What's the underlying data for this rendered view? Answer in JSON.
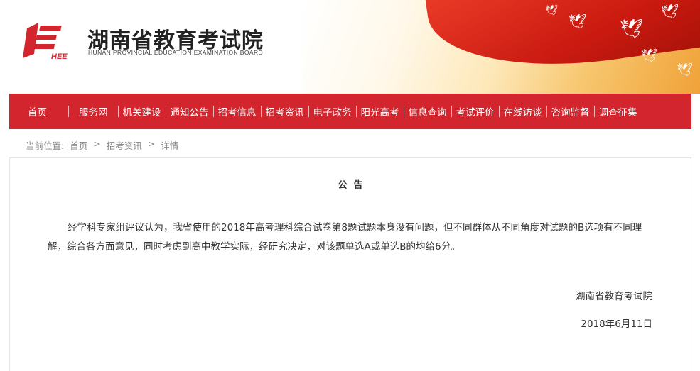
{
  "header": {
    "title": "湖南省教育考试院",
    "subtitle": "HUNAN PROVINCIAL EDUCATION EXAMINATION BOARD",
    "logo_text": "HEE",
    "brand_color": "#d2252d"
  },
  "nav": {
    "items": [
      "首页",
      "服务网",
      "机关建设",
      "通知公告",
      "招考信息",
      "招考资讯",
      "电子政务",
      "阳光高考",
      "信息查询",
      "考试评价",
      "在线访谈",
      "咨询监督",
      "调查征集"
    ]
  },
  "breadcrumb": {
    "prefix": "当前位置:",
    "items": [
      "首页",
      "招考资讯",
      "详情"
    ],
    "separator": ">"
  },
  "notice": {
    "title": "公  告",
    "body": "经学科专家组评议认为，我省使用的2018年高考理科综合试卷第8题试题本身没有问题，但不同群体从不同角度对试题的B选项有不同理解，综合各方面意见，同时考虑到高中教学实际，经研究决定，对该题单选A或单选B的均给6分。",
    "org": "湖南省教育考试院",
    "date": "2018年6月11日"
  }
}
